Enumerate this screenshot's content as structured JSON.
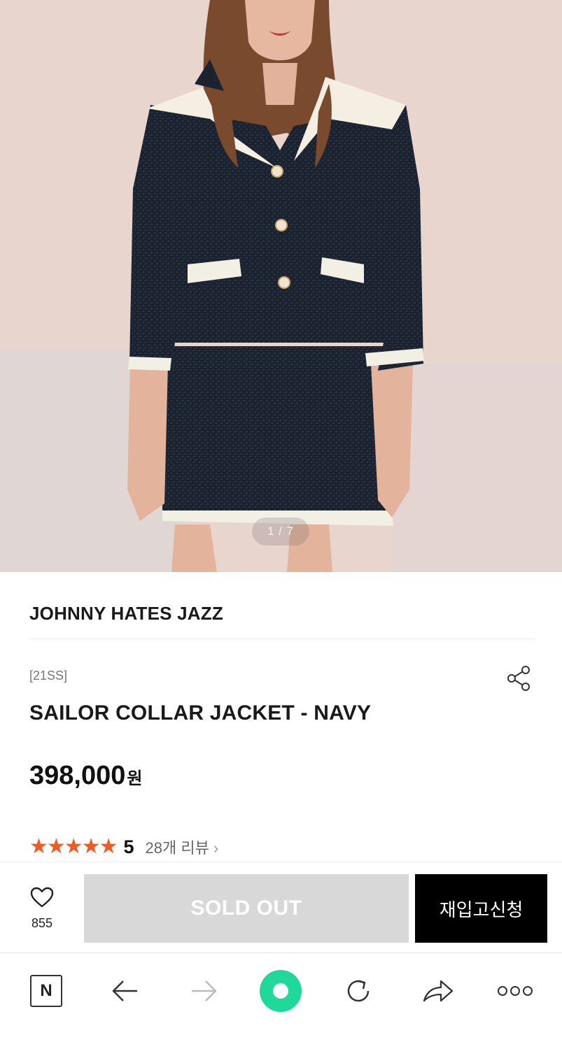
{
  "product_image": {
    "counter": "1 / 7",
    "alt": "navy tweed sailor collar jacket and skirt"
  },
  "product": {
    "brand": "JOHNNY HATES JAZZ",
    "season": "[21SS]",
    "title": "SAILOR COLLAR JACKET - NAVY",
    "price": "398,000",
    "currency": "원"
  },
  "rating": {
    "stars": "★★★★★",
    "score": "5",
    "review_count": "28개 리뷰",
    "chevron": "›"
  },
  "actions": {
    "like_count": "855",
    "soldout_label": "SOLD OUT",
    "restock_label": "재입고신청"
  },
  "toolbar": {
    "home_label": "N",
    "icons": [
      "naver-home-icon",
      "back-arrow-icon",
      "forward-arrow-icon",
      "green-dot-icon",
      "refresh-icon",
      "share-arrow-icon",
      "more-icon"
    ]
  },
  "colors": {
    "star": "#f05a24",
    "soldout_bg": "#d8d8d8",
    "restock_bg": "#000000",
    "green_dot": "#1fd89a"
  }
}
